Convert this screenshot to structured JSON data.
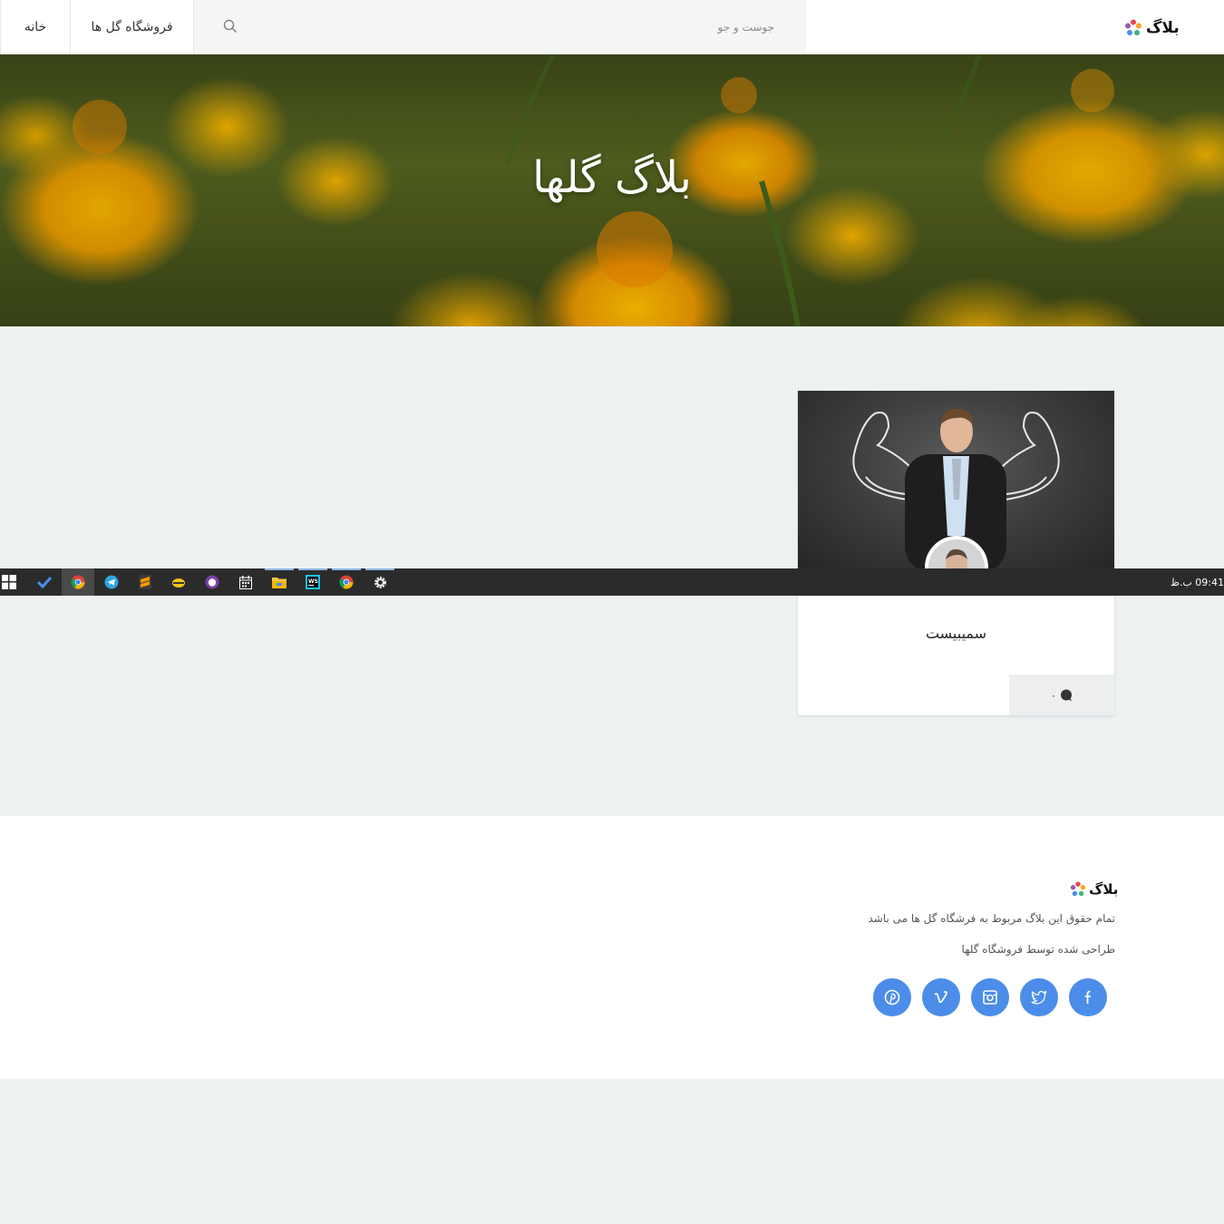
{
  "navbar": {
    "home_label": "خانه",
    "shop_label": "فروشگاه گل ها",
    "search_placeholder": "جوست و جو",
    "brand_text": "بلاگ"
  },
  "hero": {
    "title": "بلاگ گلها"
  },
  "post": {
    "title": "سمیبیست",
    "comment_count": "۰"
  },
  "taskbar": {
    "items": [
      "start-icon",
      "todo-icon",
      "chrome-icon",
      "telegram-icon",
      "sublime-icon",
      "app-icon",
      "app-icon",
      "calendar-icon",
      "file-explorer-icon",
      "webstorm-icon",
      "chrome-icon",
      "settings-icon"
    ],
    "clock": "09:41 ب.ظ"
  },
  "footer": {
    "brand_text": "بلاگ",
    "line1": "تمام حقوق این بلاگ مربوط به فرشگاه گل ها می باشد",
    "line2": "طراحی شده توسط فروشگاه گلها",
    "social": [
      "pinterest-icon",
      "vimeo-icon",
      "instagram-icon",
      "twitter-icon",
      "facebook-icon"
    ]
  },
  "colors": {
    "accent": "#4b8de8",
    "page_bg": "#edf1f2",
    "taskbar_bg": "#2b2b2b"
  }
}
